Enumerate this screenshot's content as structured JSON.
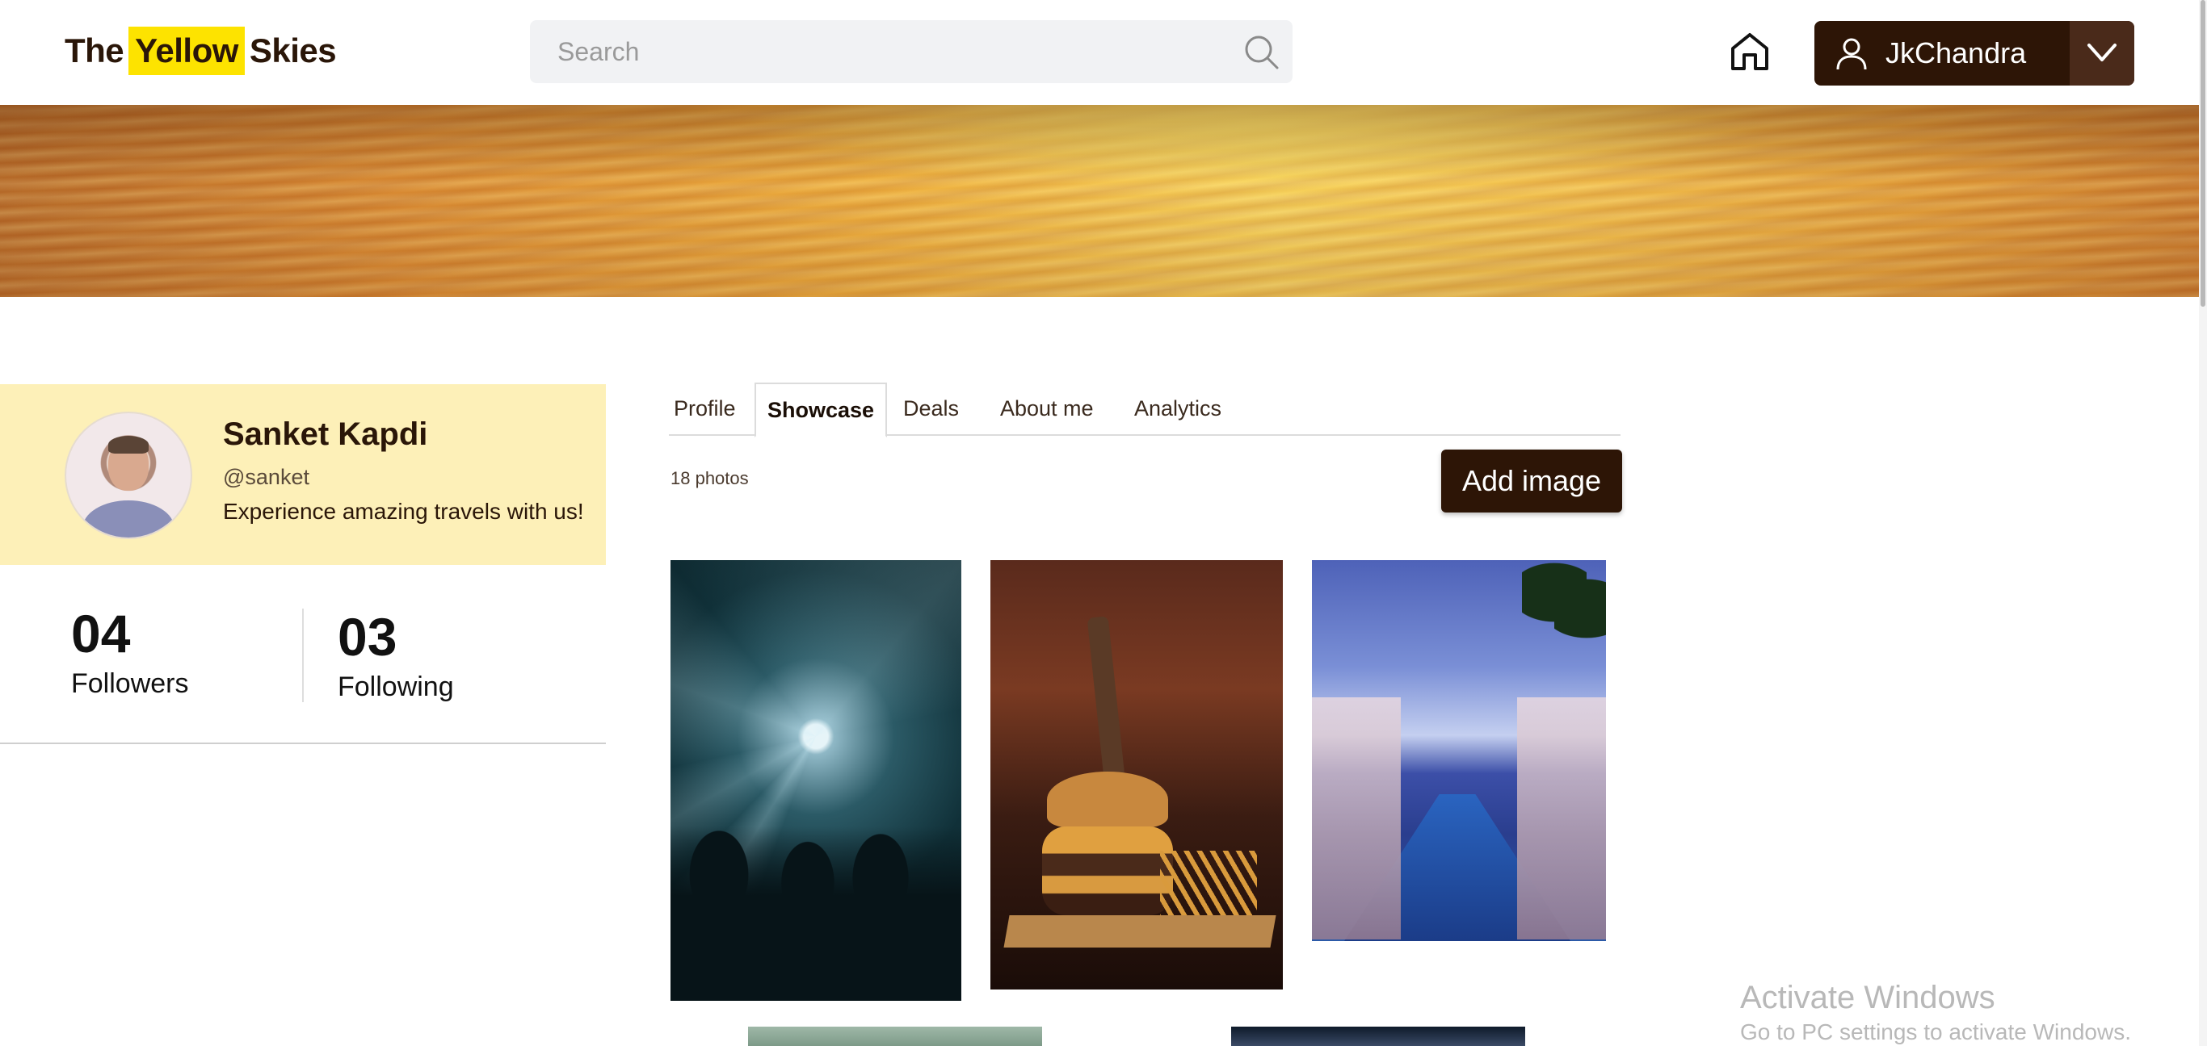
{
  "header": {
    "logo": {
      "part1": "The",
      "part2": "Yellow",
      "part3": "Skies"
    },
    "search": {
      "placeholder": "Search"
    },
    "user": {
      "name": "JkChandra"
    }
  },
  "profile": {
    "name": "Sanket Kapdi",
    "handle": "@sanket",
    "bio": "Experience amazing travels with us!",
    "stats": [
      {
        "value": "04",
        "label": "Followers"
      },
      {
        "value": "03",
        "label": "Following"
      }
    ]
  },
  "tabs": [
    {
      "label": "Profile",
      "active": false
    },
    {
      "label": "Showcase",
      "active": true
    },
    {
      "label": "Deals",
      "active": false
    },
    {
      "label": "About me",
      "active": false
    },
    {
      "label": "Analytics",
      "active": false
    }
  ],
  "showcase": {
    "photo_count": "18 photos",
    "add_button": "Add image",
    "photos": [
      {
        "name": "concert-photo"
      },
      {
        "name": "burger-photo"
      },
      {
        "name": "resort-pool-photo"
      },
      {
        "name": "landscape-photo"
      },
      {
        "name": "planet-photo"
      }
    ]
  },
  "watermark": {
    "title": "Activate Windows",
    "subtitle": "Go to PC settings to activate Windows."
  },
  "colors": {
    "brand_dark": "#2d1506",
    "logo_highlight": "#fde300",
    "profile_card_bg": "#fdf0b8"
  }
}
